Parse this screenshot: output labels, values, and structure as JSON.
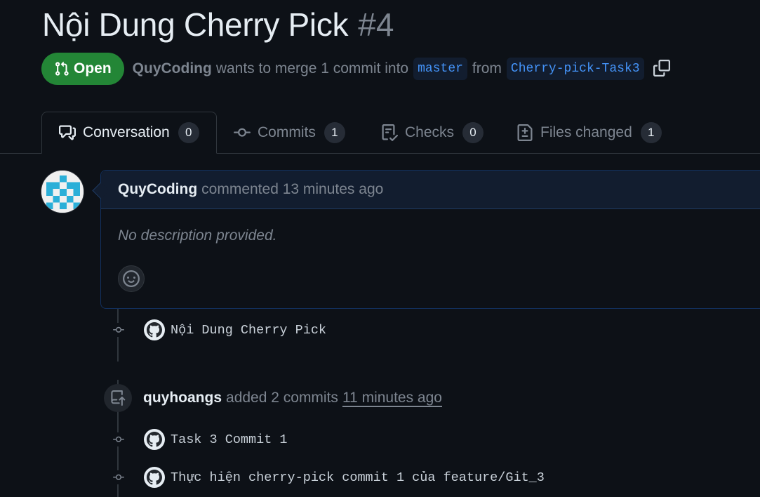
{
  "pull_request": {
    "title": "Nội Dung Cherry Pick",
    "number": "#4",
    "state": "Open",
    "author": "QuyCoding",
    "merge_text": "wants to merge 1 commit into",
    "base_branch": "master",
    "from_text": "from",
    "head_branch": "Cherry-pick-Task3"
  },
  "tabs": [
    {
      "label": "Conversation",
      "count": "0",
      "icon": "comment-discussion-icon"
    },
    {
      "label": "Commits",
      "count": "1",
      "icon": "git-commit-icon"
    },
    {
      "label": "Checks",
      "count": "0",
      "icon": "checklist-icon"
    },
    {
      "label": "Files changed",
      "count": "1",
      "icon": "file-diff-icon"
    }
  ],
  "comment": {
    "author": "QuyCoding",
    "meta": "commented 13 minutes ago",
    "body": "No description provided."
  },
  "timeline": {
    "first_commit": "Nội Dung Cherry Pick",
    "event": {
      "author": "quyhoangs",
      "action": "added 2 commits",
      "time": "11 minutes ago"
    },
    "commits": [
      "Task 3 Commit 1",
      "Thực hiện cherry-pick commit 1 của feature/Git_3"
    ]
  },
  "colors": {
    "background": "#0d1117",
    "open_green": "#238636",
    "branch_blue": "#4493f8",
    "muted_text": "#7d8590"
  }
}
